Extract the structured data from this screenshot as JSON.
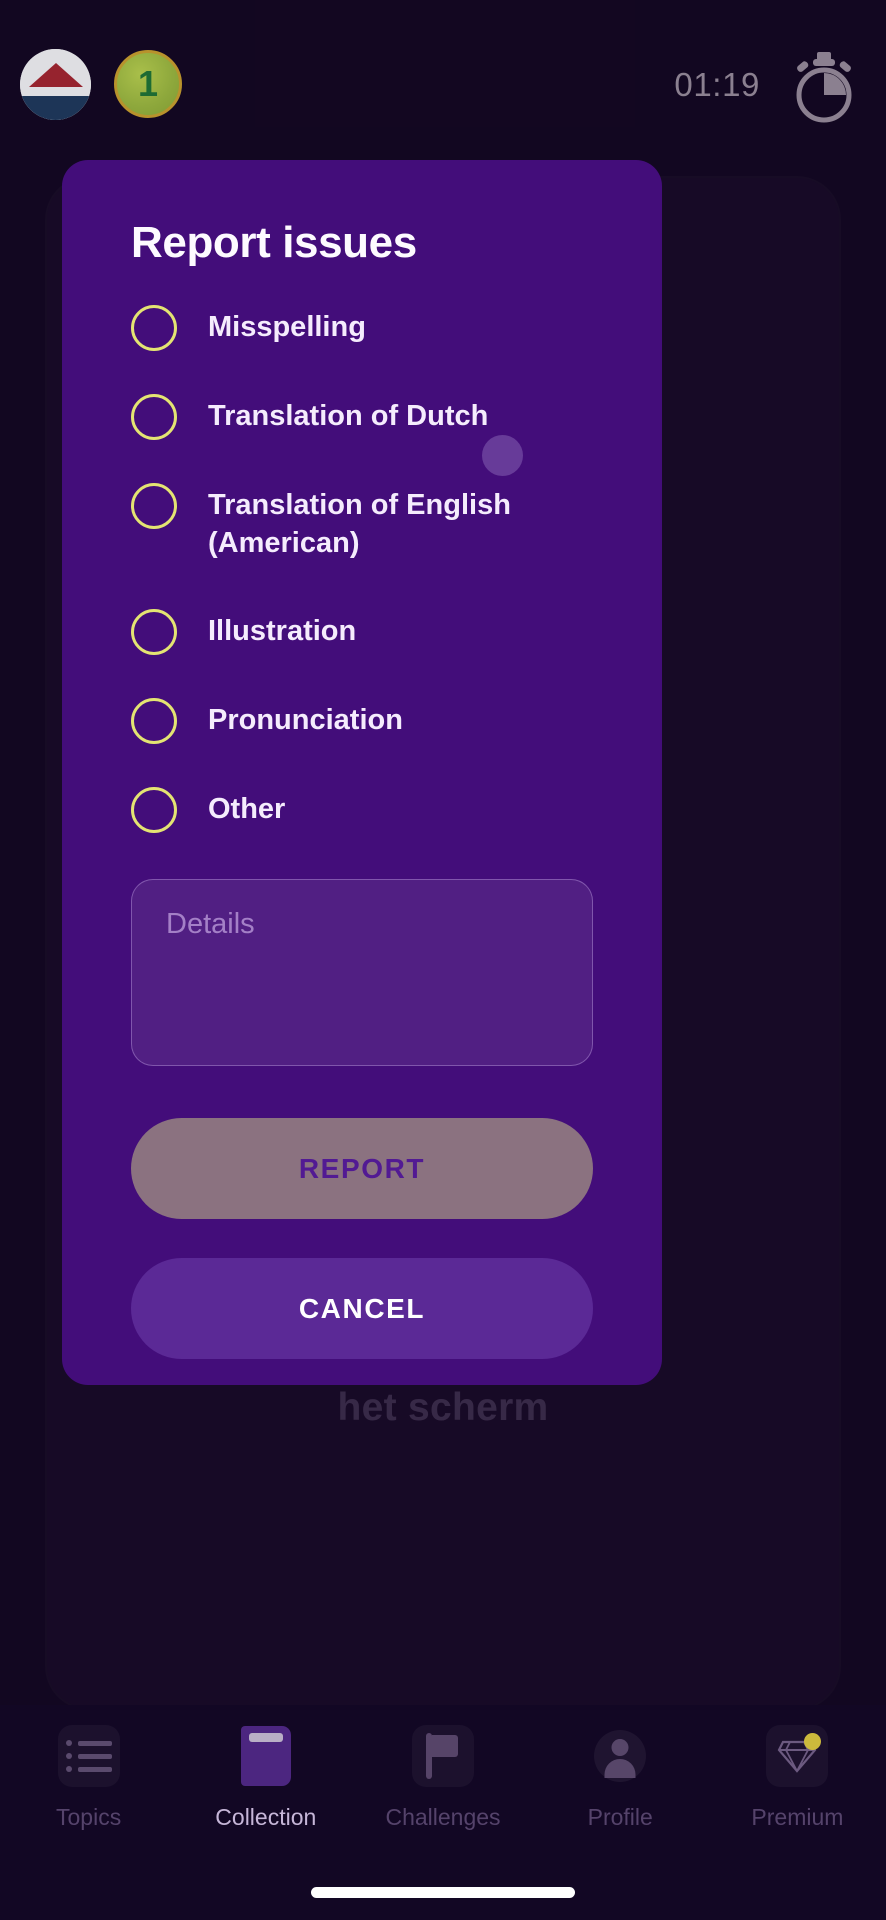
{
  "theme": {
    "app_background": "#190a2b",
    "dialog_background": "#430d7a",
    "radio_outline": "#e4e472",
    "report_button_bg": "#8b7280",
    "report_button_text": "#521a93",
    "cancel_button_bg": "#5b2996",
    "nav_background": "#120724",
    "accent_badge": "#cbb93c"
  },
  "topbar": {
    "flag_icon": "dutch-flag-icon",
    "coin_icon": "coin-icon",
    "coin_value": "1",
    "timer": "01:19",
    "timer_icon": "stopwatch-icon"
  },
  "background": {
    "word_behind": "het scherm"
  },
  "dialog": {
    "title": "Report issues",
    "options": [
      {
        "label": "Misspelling",
        "selected": false
      },
      {
        "label": "Translation of Dutch",
        "selected": false
      },
      {
        "label": "Translation of English (American)",
        "selected": false
      },
      {
        "label": "Illustration",
        "selected": false
      },
      {
        "label": "Pronunciation",
        "selected": false
      },
      {
        "label": "Other",
        "selected": false
      }
    ],
    "details": {
      "placeholder": "Details",
      "value": ""
    },
    "report_label": "REPORT",
    "cancel_label": "CANCEL"
  },
  "bottom_nav": {
    "items": [
      {
        "label": "Topics",
        "icon": "list-icon",
        "active": false
      },
      {
        "label": "Collection",
        "icon": "book-icon",
        "active": true
      },
      {
        "label": "Challenges",
        "icon": "flag-icon",
        "active": false
      },
      {
        "label": "Profile",
        "icon": "person-icon",
        "active": false
      },
      {
        "label": "Premium",
        "icon": "diamond-icon",
        "active": false
      }
    ]
  }
}
